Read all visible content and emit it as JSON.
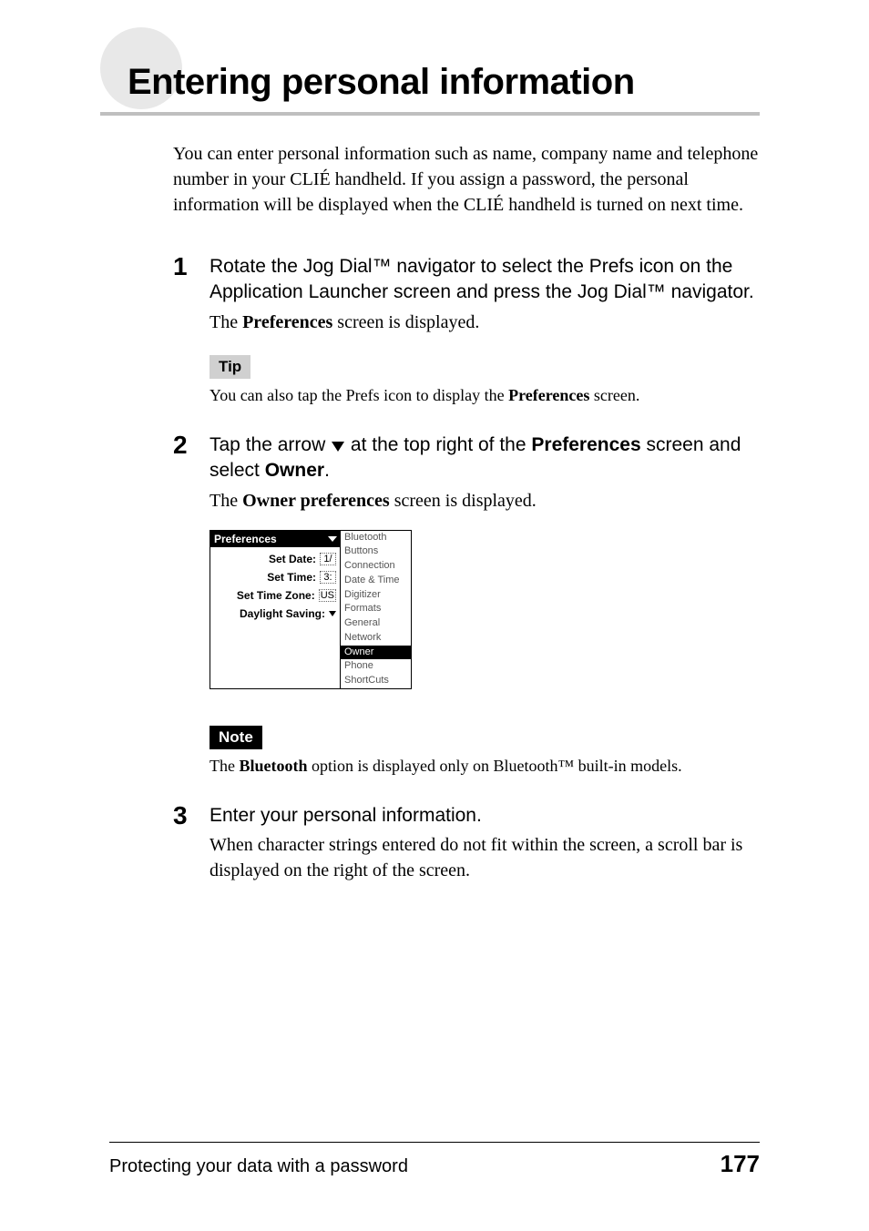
{
  "chapter_title": "Entering personal information",
  "intro": "You can enter personal information such as name, company name and telephone number in your CLIÉ handheld. If you assign a password, the personal information will be displayed when the CLIÉ handheld is turned on next time.",
  "steps": {
    "s1": {
      "num": "1",
      "instruction_a": "Rotate the Jog Dial™ navigator to select the Prefs icon on the Application Launcher screen and press the Jog Dial™ navigator.",
      "result_prefix": "The ",
      "result_bold": "Preferences",
      "result_suffix": " screen is displayed.",
      "tip_label": "Tip",
      "tip_prefix": "You can also tap the Prefs icon to display the ",
      "tip_bold": "Preferences",
      "tip_suffix": " screen."
    },
    "s2": {
      "num": "2",
      "instruction_a": "Tap the arrow ",
      "instruction_b": " at the top right of the ",
      "instruction_bold1": "Preferences",
      "instruction_c": " screen and select ",
      "instruction_bold2": "Owner",
      "instruction_d": ".",
      "result_prefix": "The ",
      "result_bold": "Owner preferences",
      "result_suffix": " screen is displayed.",
      "note_label": "Note",
      "note_prefix": "The ",
      "note_bold": "Bluetooth",
      "note_suffix": " option is displayed only on Bluetooth™ built-in models."
    },
    "s3": {
      "num": "3",
      "instruction_a": "Enter your personal information.",
      "result": "When character strings entered do not fit within the screen, a scroll bar is displayed on the right of the screen."
    }
  },
  "palm": {
    "title": "Preferences",
    "rows": {
      "date": {
        "label": "Set Date:",
        "value": "1/"
      },
      "time": {
        "label": "Set Time:",
        "value": "3:"
      },
      "tz": {
        "label": "Set Time Zone:",
        "value": "US"
      },
      "ds": {
        "label": "Daylight Saving:"
      }
    },
    "menu": [
      "Bluetooth",
      "Buttons",
      "Connection",
      "Date & Time",
      "Digitizer",
      "Formats",
      "General",
      "Network",
      "Owner",
      "Phone",
      "ShortCuts"
    ],
    "menu_selected": "Owner"
  },
  "footer": {
    "section": "Protecting your data with a password",
    "page": "177"
  }
}
